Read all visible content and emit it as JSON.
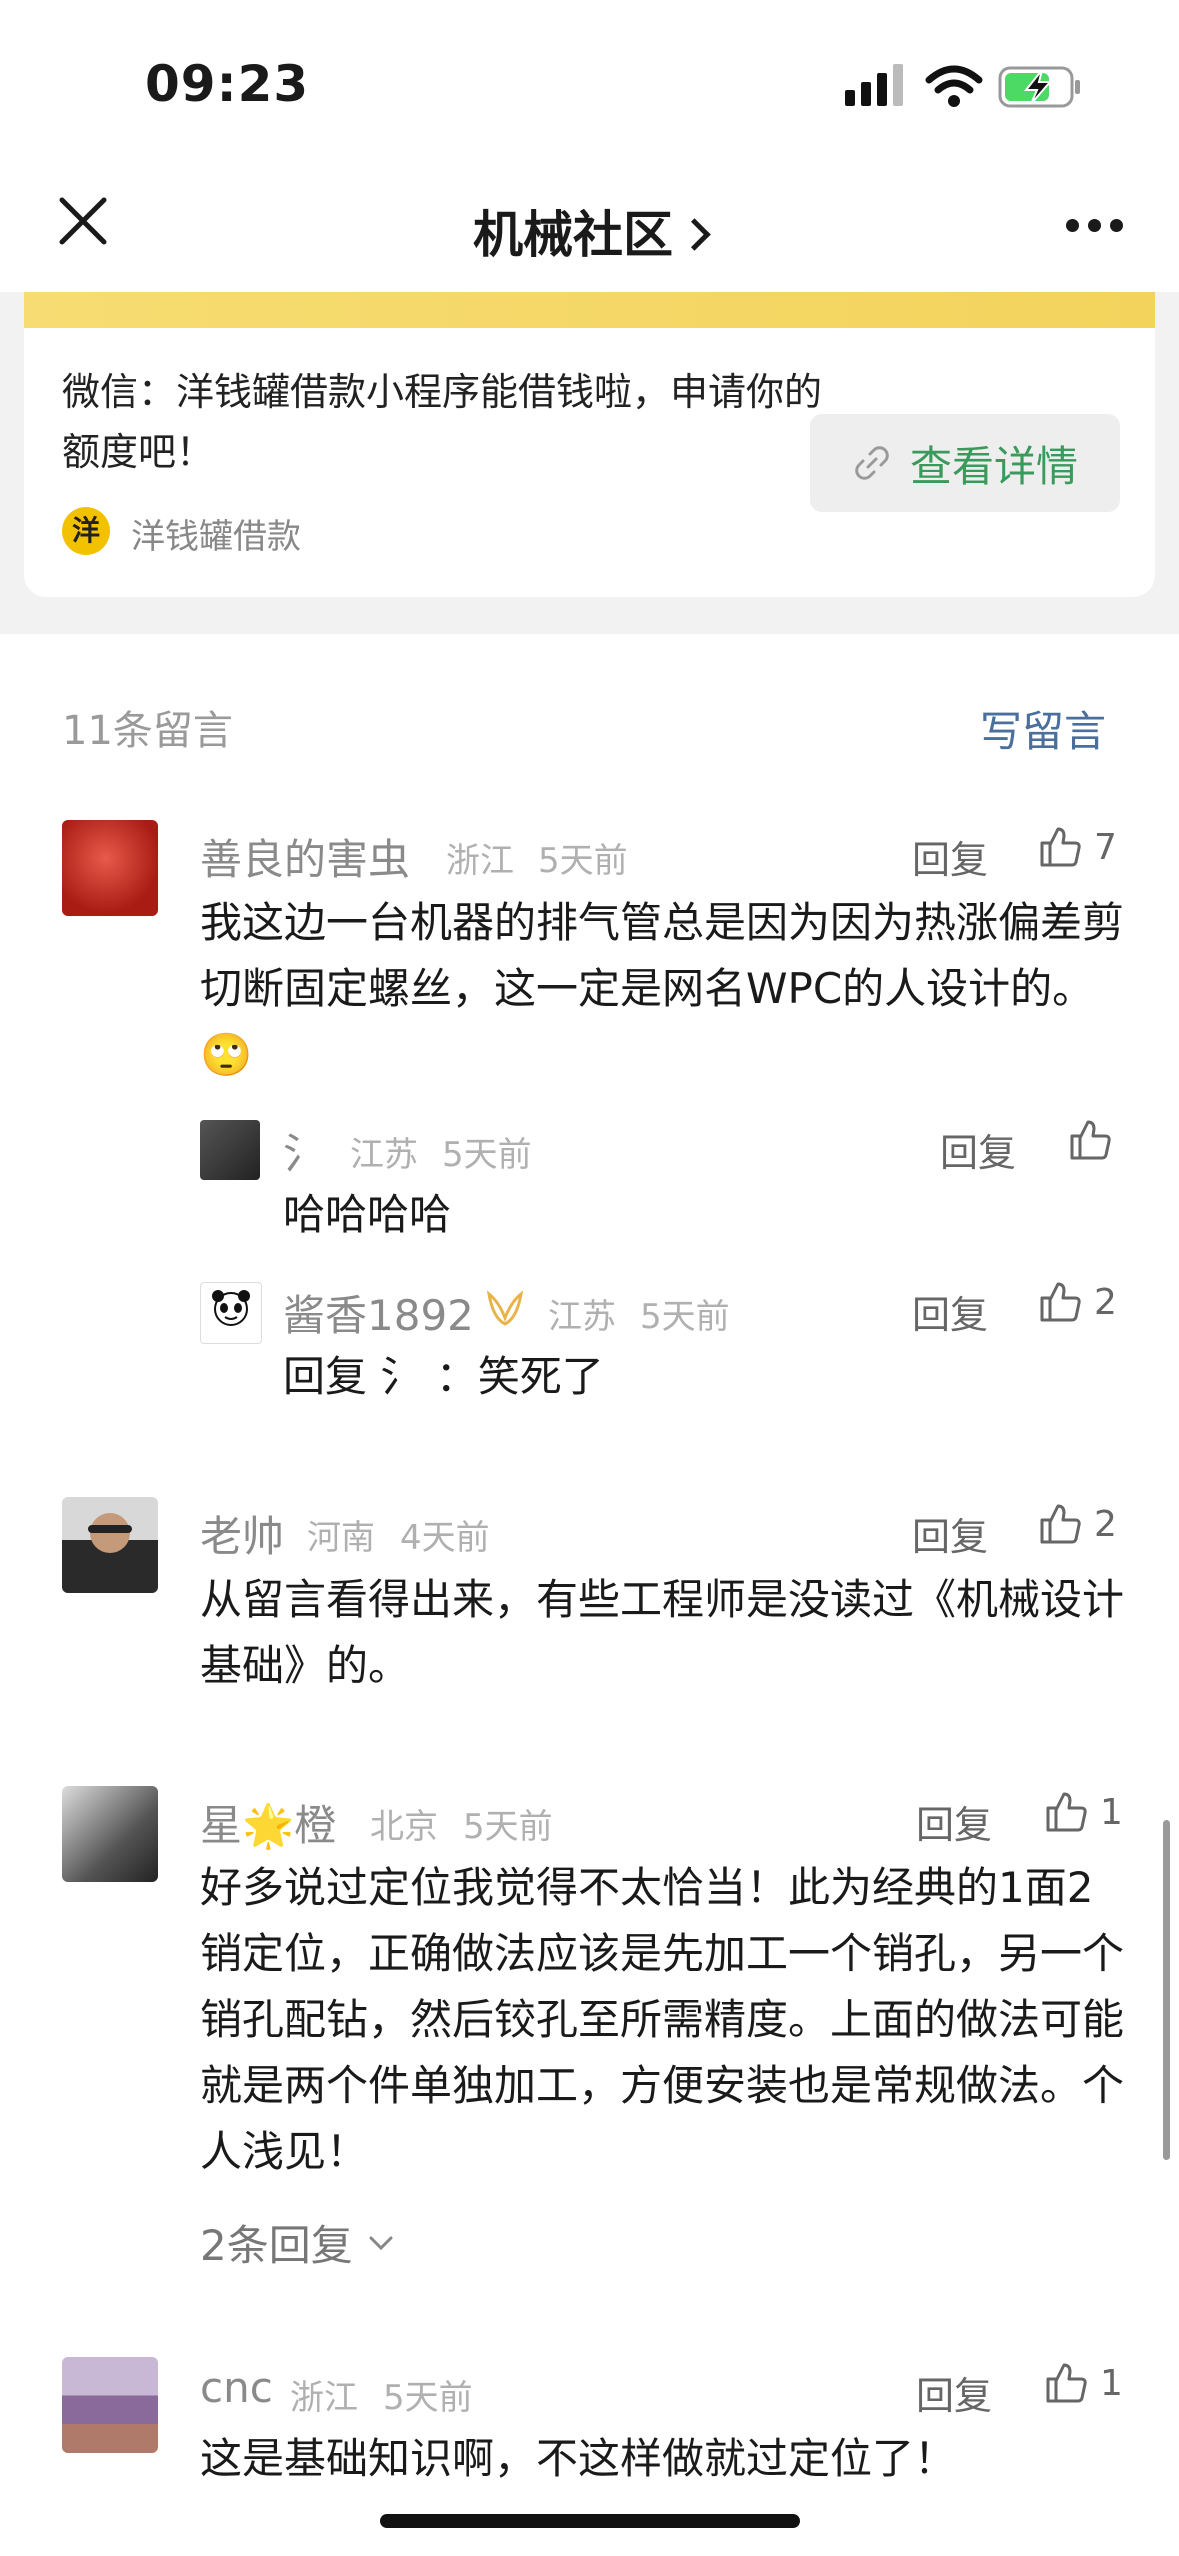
{
  "status_bar": {
    "time": "09:23"
  },
  "nav": {
    "title": "机械社区"
  },
  "ad": {
    "text": "微信：洋钱罐借款小程序能借钱啦，申请你的额度吧！",
    "brand_logo": "洋",
    "brand": "洋钱罐借款",
    "button": "查看详情"
  },
  "comments_header": {
    "count": "11条留言",
    "write": "写留言"
  },
  "comments": [
    {
      "name": "善良的害虫",
      "location": "浙江",
      "time": "5天前",
      "reply": "回复",
      "likes": "7",
      "body": "我这边一台机器的排气管总是因为因为热涨偏差剪切断固定螺丝，这一定是网名WPC的人设计的。🙄",
      "replies": [
        {
          "name": "氵",
          "location": "江苏",
          "time": "5天前",
          "reply": "回复",
          "likes": "",
          "body": "哈哈哈哈"
        },
        {
          "name": "酱香1892",
          "location": "江苏",
          "time": "5天前",
          "reply": "回复",
          "likes": "2",
          "body": "回复 氵 ：笑死了"
        }
      ]
    },
    {
      "name": "老帅",
      "location": "河南",
      "time": "4天前",
      "reply": "回复",
      "likes": "2",
      "body": "从留言看得出来，有些工程师是没读过《机械设计基础》的。"
    },
    {
      "name": "星🌟橙",
      "location": "北京",
      "time": "5天前",
      "reply": "回复",
      "likes": "1",
      "body": "好多说过定位我觉得不太恰当！此为经典的1面2销定位，正确做法应该是先加工一个销孔，另一个销孔配钻，然后铰孔至所需精度。上面的做法可能就是两个件单独加工，方便安装也是常规做法。个人浅见！",
      "more_replies": "2条回复"
    },
    {
      "name": "cnc",
      "location": "浙江",
      "time": "5天前",
      "reply": "回复",
      "likes": "1",
      "body": "这是基础知识啊，不这样做就过定位了！"
    }
  ]
}
